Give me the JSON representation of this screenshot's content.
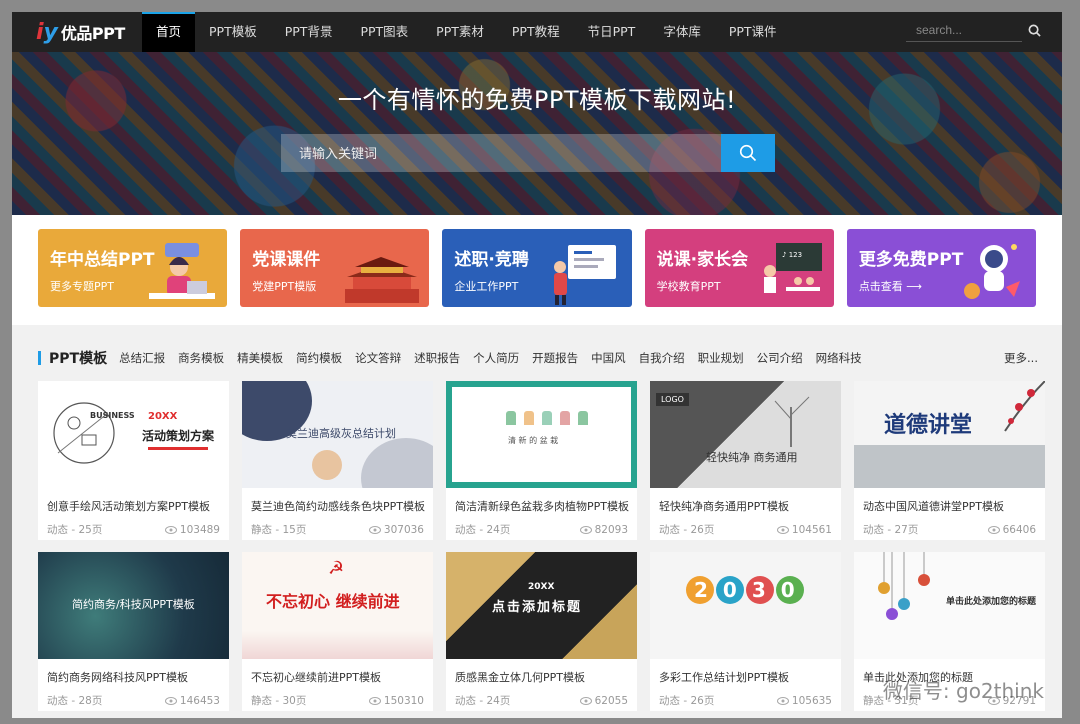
{
  "brand": {
    "logo_text": "优品PPT"
  },
  "nav": {
    "items": [
      "首页",
      "PPT模板",
      "PPT背景",
      "PPT图表",
      "PPT素材",
      "PPT教程",
      "节日PPT",
      "字体库",
      "PPT课件"
    ],
    "search_placeholder": "search..."
  },
  "hero": {
    "title": "一个有情怀的免费PPT模板下载网站!",
    "search_placeholder": "请输入关键词"
  },
  "banners": [
    {
      "title": "年中总结PPT",
      "sub": "更多专题PPT",
      "color": "#e9a93a"
    },
    {
      "title": "党课课件",
      "sub": "党建PPT模版",
      "color": "#e8674c"
    },
    {
      "title": "述职·竞聘",
      "sub": "企业工作PPT",
      "color": "#2a5fb8"
    },
    {
      "title": "说课·家长会",
      "sub": "学校教育PPT",
      "color": "#d43f7e"
    },
    {
      "title": "更多免费PPT",
      "sub": "点击查看 ⟶",
      "color": "#8a4fd6"
    }
  ],
  "section": {
    "title": "PPT模板",
    "categories": [
      "总结汇报",
      "商务模板",
      "精美模板",
      "简约模板",
      "论文答辩",
      "述职报告",
      "个人简历",
      "开题报告",
      "中国风",
      "自我介绍",
      "职业规划",
      "公司介绍",
      "网络科技"
    ],
    "more": "更多..."
  },
  "cards": [
    {
      "title": "创意手绘风活动策划方案PPT模板",
      "meta": "动态 - 25页",
      "views": "103489"
    },
    {
      "title": "莫兰迪色简约动感线条色块PPT模板",
      "meta": "静态 - 15页",
      "views": "307036"
    },
    {
      "title": "简洁清新绿色盆栽多肉植物PPT模板",
      "meta": "动态 - 24页",
      "views": "82093"
    },
    {
      "title": "轻快纯净商务通用PPT模板",
      "meta": "动态 - 26页",
      "views": "104561"
    },
    {
      "title": "动态中国风道德讲堂PPT模板",
      "meta": "动态 - 27页",
      "views": "66406"
    },
    {
      "title": "简约商务网络科技风PPT模板",
      "meta": "动态 - 28页",
      "views": "146453"
    },
    {
      "title": "不忘初心继续前进PPT模板",
      "meta": "静态 - 30页",
      "views": "150310"
    },
    {
      "title": "质感黑金立体几何PPT模板",
      "meta": "动态 - 24页",
      "views": "62055"
    },
    {
      "title": "多彩工作总结计划PPT模板",
      "meta": "动态 - 26页",
      "views": "105635"
    },
    {
      "title": "单击此处添加您的标题",
      "meta": "静态 - 31页",
      "views": "92791"
    }
  ],
  "thumbs": {
    "t1": {
      "l1": "20XX",
      "l2": "活动策划方案",
      "l3": "BUSINESS"
    },
    "t2": {
      "l1": "莫兰迪高级灰总结计划"
    },
    "t3": {
      "l1": "清 新 的 盆 栽"
    },
    "t4": {
      "l1": "LOGO",
      "l2": "轻快纯净 商务通用"
    },
    "t5": {
      "l1": "道德讲堂"
    },
    "t6": {
      "l1": "简约商务/科技风PPT模板"
    },
    "t7": {
      "l1": "不忘初心 继续前进"
    },
    "t8": {
      "l1": "20XX",
      "l2": "点击添加标题"
    },
    "t9": {
      "l1": "2030"
    },
    "t10": {
      "l1": "单击此处添加您的标题"
    }
  },
  "watermark": "微信号: go2think"
}
